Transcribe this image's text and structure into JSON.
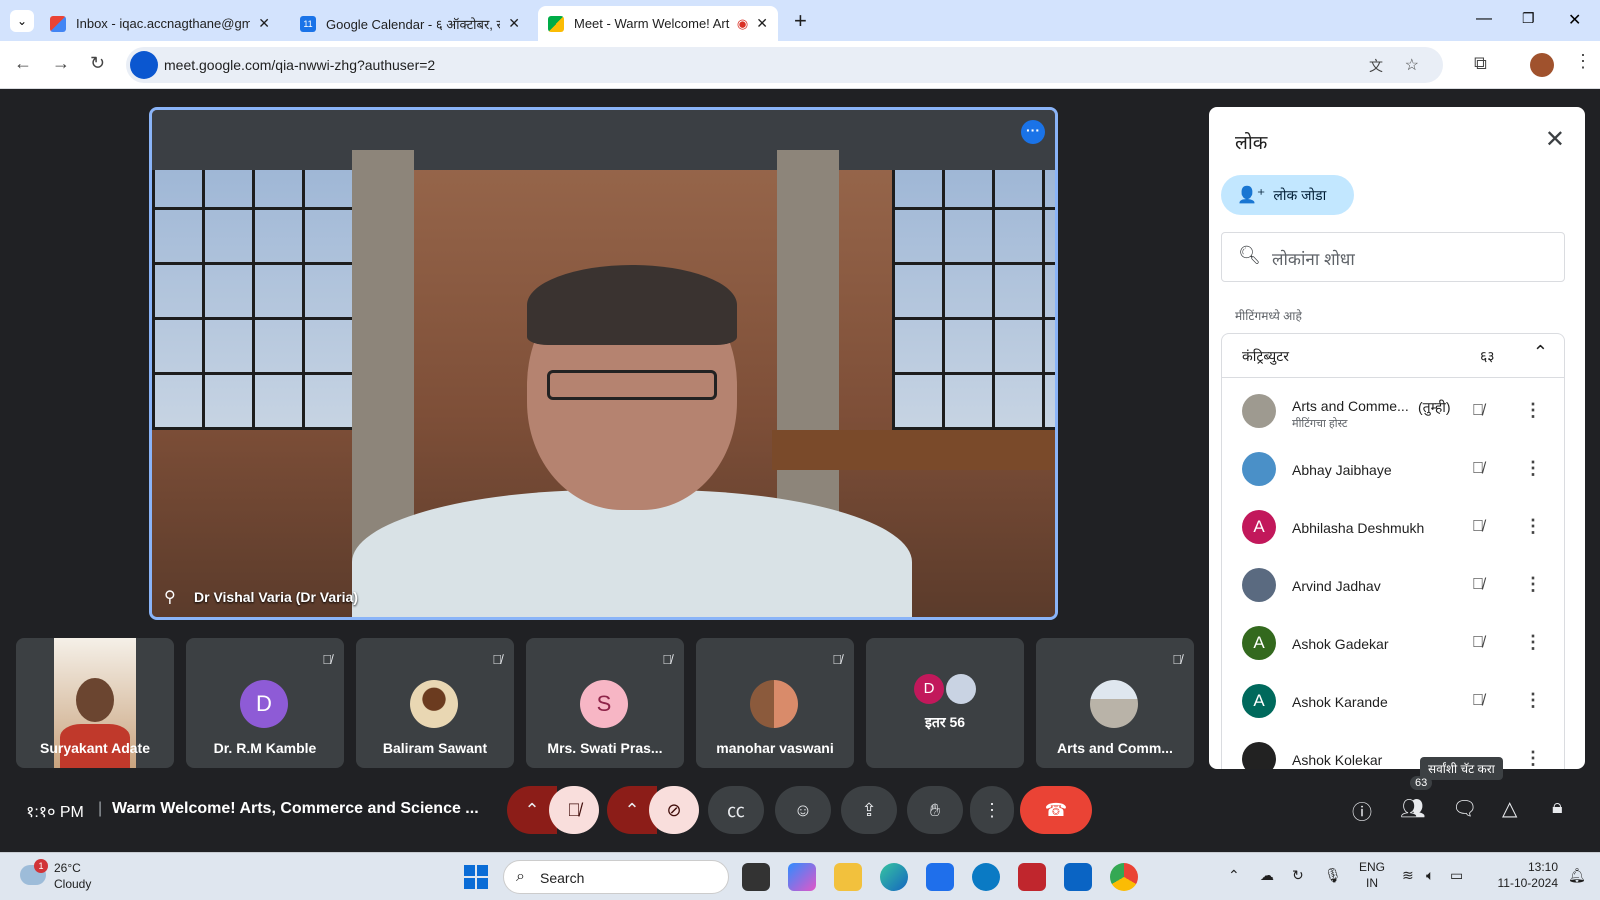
{
  "browser": {
    "tabs": [
      {
        "title": "Inbox - iqac.accnagthane@gma",
        "active": false
      },
      {
        "title": "Google Calendar - ६ ऑक्टोबर, र",
        "active": false
      },
      {
        "title": "Meet - Warm Welcome! Art",
        "active": true
      }
    ],
    "new_tab": "+",
    "url": "meet.google.com/qia-nwwi-zhg?authuser=2"
  },
  "main_video": {
    "name": "Dr Vishal Varia (Dr Varia)"
  },
  "tiles": [
    {
      "name": "Suryakant Adate",
      "type": "video"
    },
    {
      "name": "Dr. R.M Kamble",
      "avatar_letter": "D",
      "avatar_color": "#8e5bd6"
    },
    {
      "name": "Baliram Sawant",
      "avatar_color": "#e9d7b3"
    },
    {
      "name": "Mrs. Swati Pras...",
      "avatar_letter": "S",
      "avatar_color": "#f7b6c5"
    },
    {
      "name": "manohar vaswani",
      "avatar_color": "#d98b6a"
    },
    {
      "name": "इतर 56",
      "avatar_letter": "D",
      "avatar_color": "#c2185b"
    },
    {
      "name": "Arts and Comm...",
      "avatar_color": "#b9b3a8"
    }
  ],
  "panel": {
    "title": "लोक",
    "add_people": "लोक जोडा",
    "search_placeholder": "लोकांना शोधा",
    "in_meeting": "मीटिंगमध्ये आहे",
    "contributors_label": "कंट्रिब्युटर",
    "contributors_count": "६३",
    "participants": [
      {
        "name": "Arts and Comme...",
        "you": "(तुम्ही)",
        "sub": "मीटिंगचा होस्ट",
        "avatar_color": "#9e9a90"
      },
      {
        "name": "Abhay Jaibhaye",
        "avatar_color": "#4a90c8"
      },
      {
        "name": "Abhilasha Deshmukh",
        "avatar_letter": "A",
        "avatar_color": "#c2185b"
      },
      {
        "name": "Arvind Jadhav",
        "avatar_color": "#5a6a80"
      },
      {
        "name": "Ashok Gadekar",
        "avatar_letter": "A",
        "avatar_color": "#33691e"
      },
      {
        "name": "Ashok Karande",
        "avatar_letter": "A",
        "avatar_color": "#00695c"
      },
      {
        "name": "Ashok Kolekar",
        "avatar_color": "#222222"
      }
    ],
    "tooltip": "सर्वांशी चॅट करा"
  },
  "controls": {
    "clock": "१:१० PM",
    "separator": "|",
    "meeting_title": "Warm Welcome! Arts, Commerce and Science ...",
    "people_count": "63"
  },
  "taskbar": {
    "temp": "26°C",
    "condition": "Cloudy",
    "weather_badge": "1",
    "search": "Search",
    "lang_1": "ENG",
    "lang_2": "IN",
    "time": "13:10",
    "date": "11-10-2024"
  }
}
